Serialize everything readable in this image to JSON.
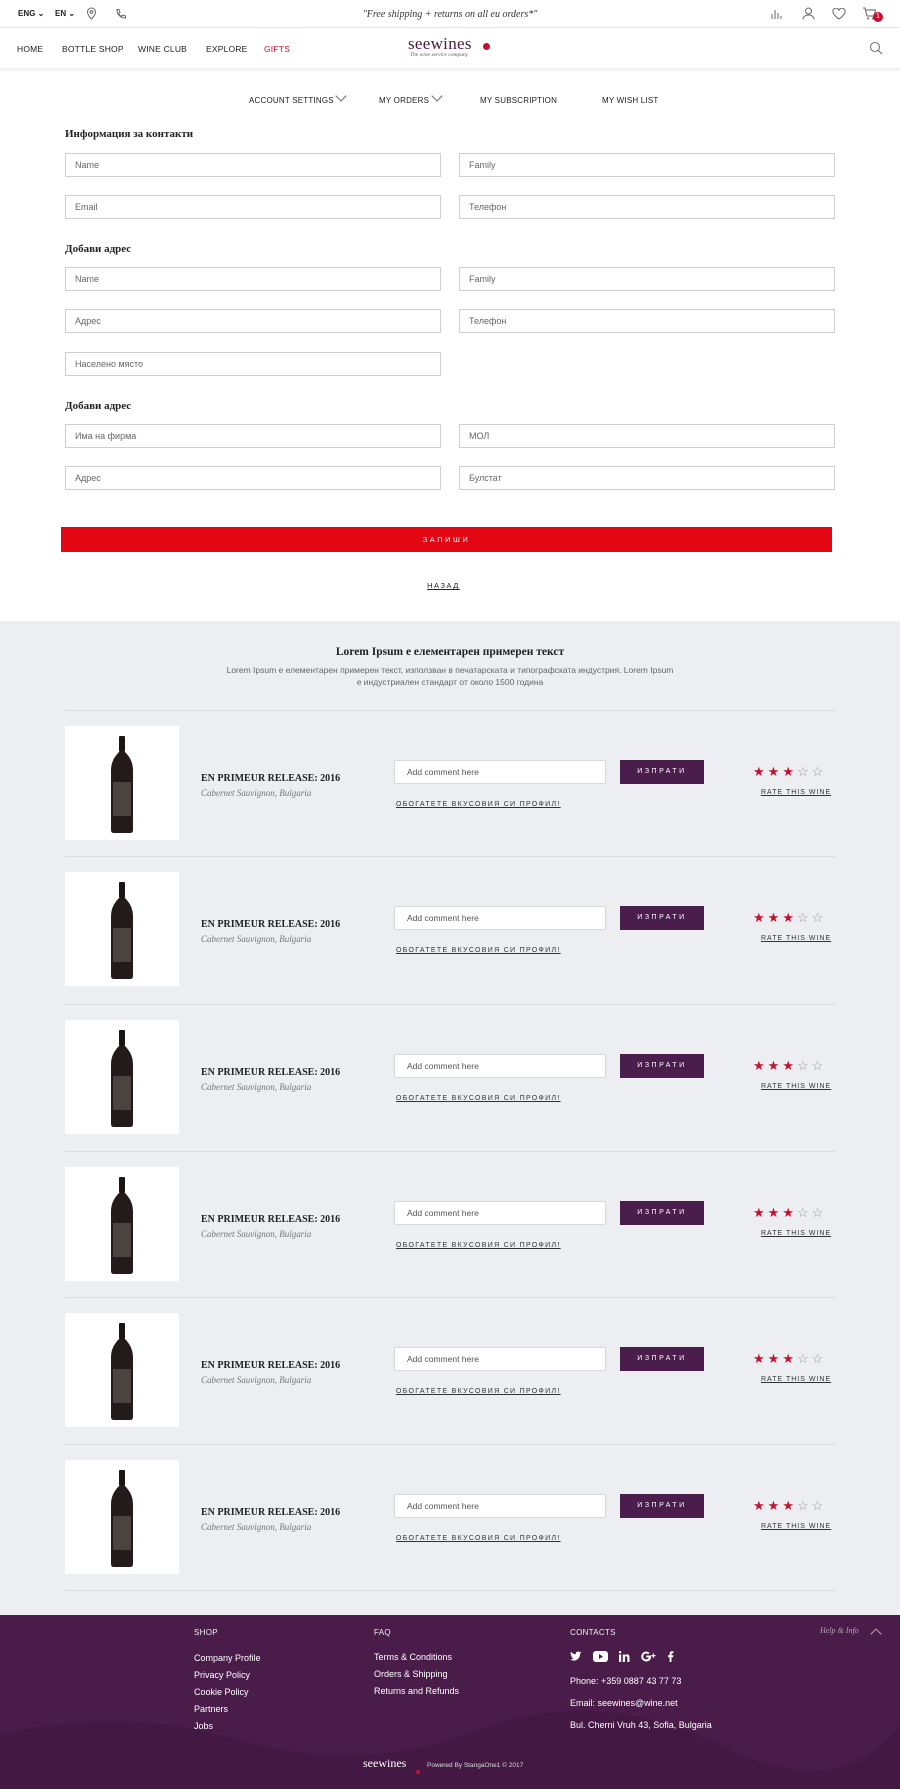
{
  "topbar": {
    "lang1": "ENG",
    "lang2": "EN",
    "shipping": "\"Free shipping + returns on all eu orders*\"",
    "cart_count": "1"
  },
  "nav": {
    "home": "HOME",
    "bottle_shop": "BOTTLE SHOP",
    "wine_club": "WINE CLUB",
    "explore": "EXPLORE",
    "gifts": "GIFTS",
    "logo": "seewines",
    "logo_tagline": "The wine service company"
  },
  "account_tabs": {
    "settings": "ACCOUNT SETTINGS",
    "orders": "MY ORDERS",
    "subscription": "MY SUBSCRIPTION",
    "wishlist": "MY WISH LIST"
  },
  "contact": {
    "title": "Информация за контакти",
    "name": "Name",
    "family": "Family",
    "email": "Email",
    "phone": "Телефон"
  },
  "address": {
    "title": "Добави адрес",
    "name": "Name",
    "family": "Family",
    "address": "Адрес",
    "phone": "Телефон",
    "city": "Населено място"
  },
  "company": {
    "title": "Добави адрес",
    "company_name": "Има на фирма",
    "mol": "МОЛ",
    "address": "Адрес",
    "bulstat": "Булстат"
  },
  "actions": {
    "save": "ЗАПИШИ",
    "back": "НАЗАД"
  },
  "reviews": {
    "title": "Lorem Ipsum е елементарен примерен текст",
    "subtitle": "Lorem Ipsum е елементарен примерен текст, използван в печатарската и типографската индустрия. Lorem Ipsum е индустриален стандарт от около 1500 година",
    "items": [
      {
        "title": "EN PRIMEUR RELEASE: 2016",
        "subtitle": "Cabernet Sauvignon, Bulgaria",
        "comment_placeholder": "Add comment here",
        "send_label": "ИЗПРАТИ",
        "enrich_label": "ОБОГАТЕТЕ ВКУСОВИЯ СИ ПРОФИЛ!",
        "rating": 3,
        "rate_label": "RATE THIS WINE"
      },
      {
        "title": "EN PRIMEUR RELEASE: 2016",
        "subtitle": "Cabernet Sauvignon, Bulgaria",
        "comment_placeholder": "Add comment here",
        "send_label": "ИЗПРАТИ",
        "enrich_label": "ОБОГАТЕТЕ ВКУСОВИЯ СИ ПРОФИЛ!",
        "rating": 3,
        "rate_label": "RATE THIS WINE"
      },
      {
        "title": "EN PRIMEUR RELEASE: 2016",
        "subtitle": "Cabernet Sauvignon, Bulgaria",
        "comment_placeholder": "Add comment here",
        "send_label": "ИЗПРАТИ",
        "enrich_label": "ОБОГАТЕТЕ ВКУСОВИЯ СИ ПРОФИЛ!",
        "rating": 3,
        "rate_label": "RATE THIS WINE"
      },
      {
        "title": "EN PRIMEUR RELEASE: 2016",
        "subtitle": "Cabernet Sauvignon, Bulgaria",
        "comment_placeholder": "Add comment here",
        "send_label": "ИЗПРАТИ",
        "enrich_label": "ОБОГАТЕТЕ ВКУСОВИЯ СИ ПРОФИЛ!",
        "rating": 3,
        "rate_label": "RATE THIS WINE"
      },
      {
        "title": "EN PRIMEUR RELEASE: 2016",
        "subtitle": "Cabernet Sauvignon, Bulgaria",
        "comment_placeholder": "Add comment here",
        "send_label": "ИЗПРАТИ",
        "enrich_label": "ОБОГАТЕТЕ ВКУСОВИЯ СИ ПРОФИЛ!",
        "rating": 3,
        "rate_label": "RATE THIS WINE"
      },
      {
        "title": "EN PRIMEUR RELEASE: 2016",
        "subtitle": "Cabernet Sauvignon, Bulgaria",
        "comment_placeholder": "Add comment here",
        "send_label": "ИЗПРАТИ",
        "enrich_label": "ОБОГАТЕТЕ ВКУСОВИЯ СИ ПРОФИЛ!",
        "rating": 3,
        "rate_label": "RATE THIS WINE"
      }
    ]
  },
  "footer": {
    "shop_heading": "SHOP",
    "shop_links": [
      "Company Profile",
      "Privacy Policy",
      "Cookie Policy",
      "Partners",
      "Jobs"
    ],
    "faq_heading": "FAQ",
    "faq_links": [
      "Terms & Conditions",
      "Orders & Shipping",
      "Returns and Refunds"
    ],
    "contacts_heading": "CONTACTS",
    "phone": "Phone: +359 0887 43 77  73",
    "email": "Email: seewines@wine.net",
    "address": "Bul. Cherni Vruh 43, Sofia, Bulgaria",
    "help": "Help & Info",
    "logo": "seewines",
    "powered": "Powered By StangaOne1 © 2017"
  },
  "colors": {
    "accent_red": "#e30613",
    "purple": "#4a1d4c",
    "star": "#c8102e"
  }
}
